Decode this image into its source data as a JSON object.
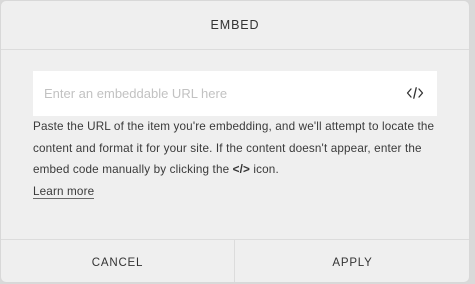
{
  "dialog": {
    "title": "EMBED",
    "url_input": {
      "value": "",
      "placeholder": "Enter an embeddable URL here"
    },
    "code_icon": "code-brackets-icon",
    "description": {
      "before": "Paste the URL of the item you're embedding, and we'll attempt to locate the content and format it for your site. If the content doesn't appear, enter the embed code manually by clicking the ",
      "code": "</>",
      "after": " icon.",
      "learn_more": "Learn more"
    },
    "buttons": {
      "cancel": "CANCEL",
      "apply": "APPLY"
    }
  },
  "colors": {
    "dialog_bg": "#efefef",
    "input_bg": "#ffffff",
    "text": "#333333",
    "placeholder": "#c2c2c2",
    "divider": "#dcdcdc"
  }
}
